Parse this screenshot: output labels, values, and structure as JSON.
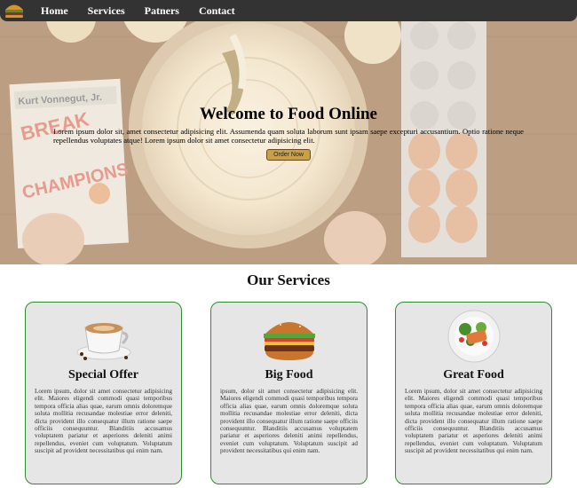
{
  "nav": {
    "logo_icon": "burger-logo-icon",
    "links": [
      "Home",
      "Services",
      "Patners",
      "Contact"
    ]
  },
  "hero": {
    "title": "Welcome to Food Online",
    "text": "Lorem ipsum dolor sit, amet consectetur adipisicing elit. Assumenda quam soluta laborum sunt ipsam saepe excepturi accusantium. Optio ratione neque repellendus voluptates atque! Lorem ipsum dolor sit amet consectetur adipisicing elit.",
    "button": "Order Now",
    "book_author": "Kurt Vonnegut, Jr.",
    "book_title": "BREAKFAST OF CHAMPIONS"
  },
  "services": {
    "title": "Our Services",
    "cards": [
      {
        "title": "Special Offer",
        "image": "coffee-cup-image",
        "text": "Lorem ipsum, dolor sit amet consectetur adipisicing elit. Maiores eligendi commodi quasi temporibus tempora officia alias quae, earum omnis doloremque soluta mollitia recusandae molestiae error deleniti, dicta provident illo consequatur illum ratione saepe officiis consequuntur. Blanditiis accusamus voluptatem pariatur et asperiores deleniti animi repellendus, eveniet cum voluptatum. Voluptatum suscipit ad provident necessitatibus qui enim nam."
      },
      {
        "title": "Big Food",
        "image": "burger-image",
        "text": "ipsum, dolor sit amet consectetur adipisicing elit. Maiores eligendi commodi quasi temporibus tempora officia alias quae, earum omnis doloremque soluta mollitia recusandae molestiae error deleniti, dicta provident illo consequatur illum ratione saepe officiis consequuntur. Blanditiis accusamus voluptatem pariatur et asperiores deleniti animi repellendus, eveniet cum voluptatum. Voluptatum suscipit ad provident necessitatibus qui enim nam."
      },
      {
        "title": "Great Food",
        "image": "salmon-salad-image",
        "text": "Lorem ipsum, dolor sit amet consectetur adipisicing elit. Maiores eligendi commodi quasi temporibus tempora officia alias quae, earum omnis doloremque soluta mollitia recusandae molestiae error deleniti, dicta provident illo consequatur illum ratione saepe officiis consequuntur. Blanditiis accusamus voluptatem pariatur et asperiores deleniti animi repellendus, eveniet cum voluptatum. Voluptatum suscipit ad provident necessitatibus qui enim nam."
      }
    ]
  },
  "colors": {
    "nav_bg": "#333333",
    "card_border": "#2e8b2e",
    "card_bg": "#e6e6e6",
    "button_bg": "#c8a04a"
  }
}
